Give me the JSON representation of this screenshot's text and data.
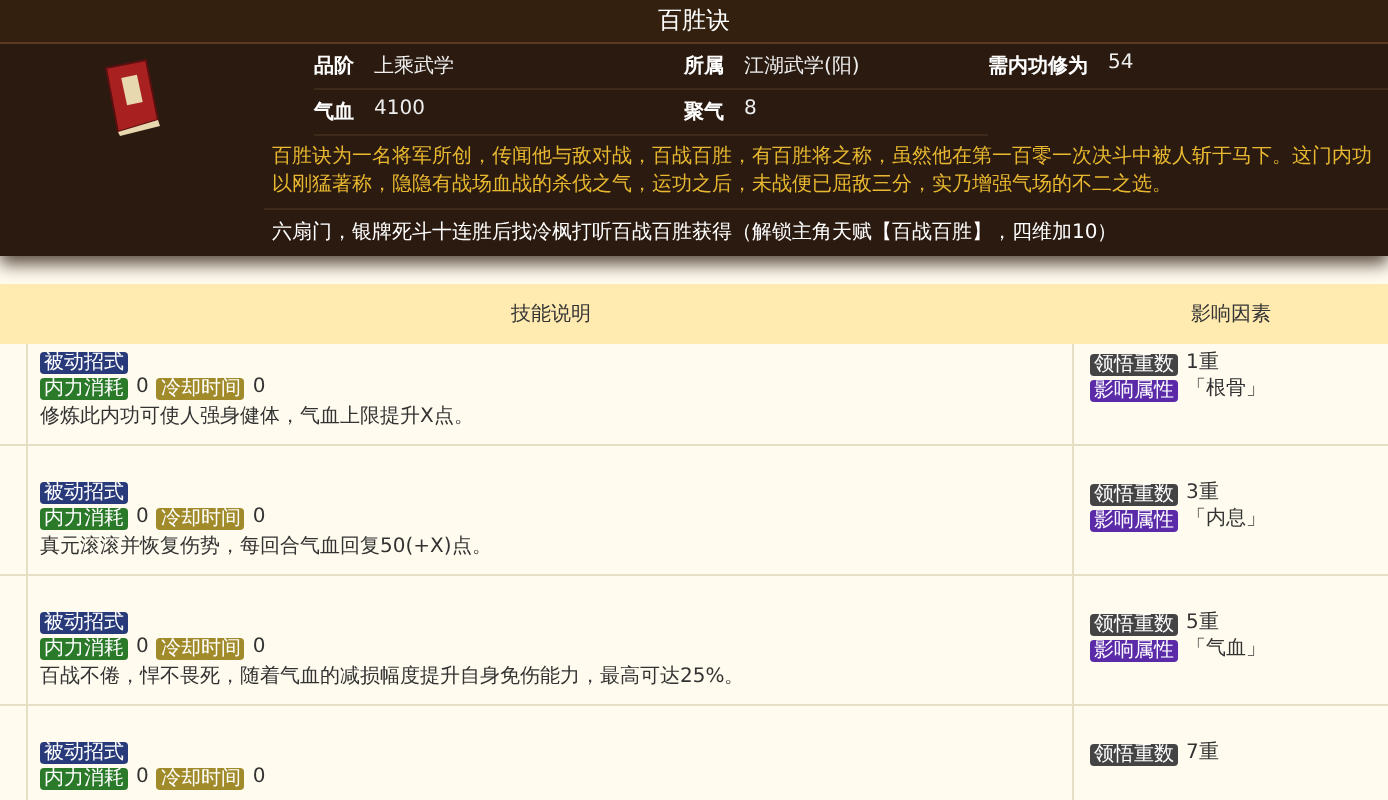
{
  "title": "百胜诀",
  "attributes": [
    {
      "label": "品阶",
      "value": "上乘武学"
    },
    {
      "label": "所属",
      "value": "江湖武学(阳)"
    },
    {
      "label": "需内功修为",
      "value": "54"
    },
    {
      "label": "气血",
      "value": "4100"
    },
    {
      "label": "聚气",
      "value": "8"
    }
  ],
  "description": "百胜诀为一名将军所创，传闻他与敌对战，百战百胜，有百胜将之称，虽然他在第一百零一次决斗中被人斩于马下。这门内功以刚猛著称，隐隐有战场血战的杀伐之气，运功之后，未战便已屈敌三分，实乃增强气场的不二之选。",
  "source": "六扇门，银牌死斗十连胜后找冷枫打听百战百胜获得（解锁主角天赋【百战百胜】，四维加10）",
  "table": {
    "columns": [
      "技能说明",
      "影响因素"
    ],
    "rows": [
      {
        "type_badge": "被动招式",
        "cost_label": "内力消耗",
        "cost": "0",
        "cooldown_label": "冷却时间",
        "cooldown": "0",
        "text": "修炼此内功可使人强身健体，气血上限提升X点。",
        "level_label": "领悟重数",
        "level_value": "1重",
        "attr_label": "影响属性",
        "attr_value": "「根骨」"
      },
      {
        "type_badge": "被动招式",
        "cost_label": "内力消耗",
        "cost": "0",
        "cooldown_label": "冷却时间",
        "cooldown": "0",
        "text": "真元滚滚并恢复伤势，每回合气血回复50(+X)点。",
        "level_label": "领悟重数",
        "level_value": "3重",
        "attr_label": "影响属性",
        "attr_value": "「内息」"
      },
      {
        "type_badge": "被动招式",
        "cost_label": "内力消耗",
        "cost": "0",
        "cooldown_label": "冷却时间",
        "cooldown": "0",
        "text": "百战不倦，悍不畏死，随着气血的减损幅度提升自身免伤能力，最高可达25%。",
        "level_label": "领悟重数",
        "level_value": "5重",
        "attr_label": "影响属性",
        "attr_value": "「气血」"
      },
      {
        "type_badge": "被动招式",
        "cost_label": "内力消耗",
        "cost": "0",
        "cooldown_label": "冷却时间",
        "cooldown": "0",
        "level_label": "领悟重数",
        "level_value": "7重"
      }
    ]
  }
}
